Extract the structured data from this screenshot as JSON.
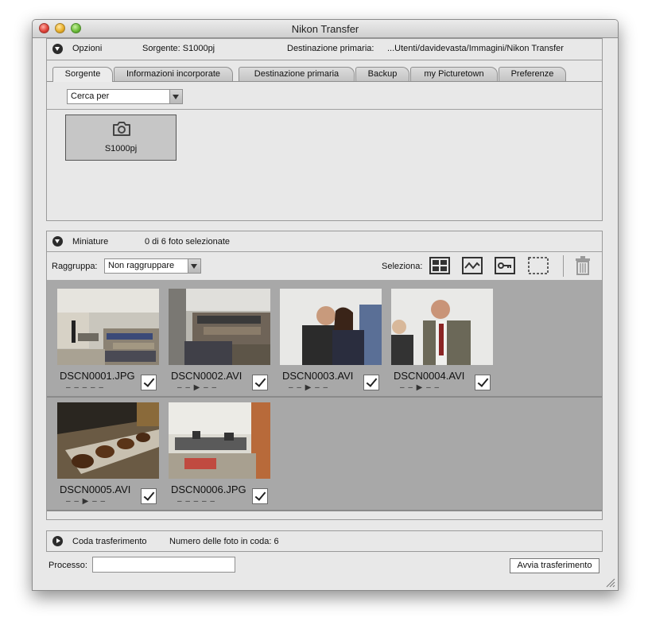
{
  "window": {
    "title": "Nikon Transfer"
  },
  "options_panel": {
    "title": "Opzioni",
    "source": "Sorgente: S1000pj",
    "destination_label": "Destinazione primaria:",
    "destination_path": "...Utenti/davidevasta/Immagini/Nikon Transfer"
  },
  "tabs": [
    {
      "label": "Sorgente",
      "active": true
    },
    {
      "label": "Informazioni incorporate",
      "active": false
    },
    {
      "label": "Destinazione primaria",
      "active": false
    },
    {
      "label": "Backup",
      "active": false
    },
    {
      "label": "my Picturetown",
      "active": false
    },
    {
      "label": "Preferenze",
      "active": false
    }
  ],
  "source_tab": {
    "search_dropdown": "Cerca per",
    "device": {
      "label": "S1000pj",
      "icon": "camera-icon"
    }
  },
  "thumbnails_panel": {
    "title": "Miniature",
    "selection_count": "0 di 6 foto selezionate",
    "group_label": "Raggruppa:",
    "group_value": "Non raggruppare",
    "select_label": "Seleziona:"
  },
  "thumbnails": [
    {
      "name": "DSCN0001.JPG",
      "meta": "– – – – –",
      "checked": true
    },
    {
      "name": "DSCN0002.AVI",
      "meta": "– – ▶ – –",
      "checked": true
    },
    {
      "name": "DSCN0003.AVI",
      "meta": "– – ▶ – –",
      "checked": true
    },
    {
      "name": "DSCN0004.AVI",
      "meta": "– – ▶ – –",
      "checked": true
    },
    {
      "name": "DSCN0005.AVI",
      "meta": "– – ▶ – –",
      "checked": true
    },
    {
      "name": "DSCN0006.JPG",
      "meta": "– – – – –",
      "checked": true
    }
  ],
  "queue_panel": {
    "title": "Coda trasferimento",
    "count": "Numero delle foto in coda: 6"
  },
  "footer": {
    "process_label": "Processo:",
    "process_value": "",
    "start_button": "Avvia trasferimento"
  }
}
